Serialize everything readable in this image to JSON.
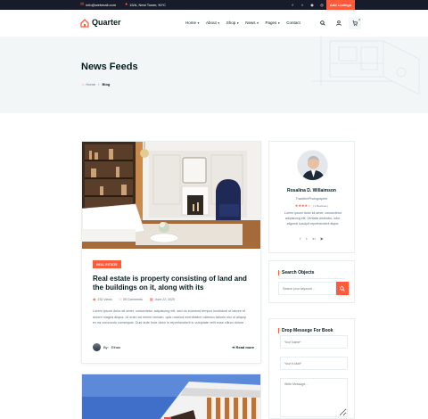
{
  "topbar": {
    "email": "info@webmail.com",
    "address": "15/A, Nest Tower, NYC",
    "social_icons": [
      "facebook-icon",
      "twitter-icon",
      "instagram-icon",
      "dribbble-icon"
    ],
    "add_listing_label": "Add Listings"
  },
  "header": {
    "logo_text": "Quarter",
    "nav": [
      {
        "label": "Home"
      },
      {
        "label": "About"
      },
      {
        "label": "Shop"
      },
      {
        "label": "News"
      },
      {
        "label": "Pages"
      },
      {
        "label": "Contact"
      }
    ],
    "cart_count": "0"
  },
  "banner": {
    "title": "News Feeds",
    "breadcrumb_home": "Home",
    "breadcrumb_current": "Blog"
  },
  "post": {
    "tag": "REAL ESTATE",
    "title": "Real estate is property consisting of land and the buildings on it, along with its",
    "views": "232 Views",
    "comments": "35 Comments",
    "date": "June 22, 2020",
    "excerpt": "Lorem ipsum dolor sit amet, consectetur adipisicing elit, sed do eiusmod tempor incididunt ut labore et dolore magna aliqua. Ut enim ad minim veniam, quis nostrud exercitation ullamco laboris nisi ut aliquip ex ea commodo consequat. Duis aute irure dolor in reprehenderit in voluptate velit esse cillum dolore",
    "author_prefix": "By:",
    "author": "Ethan",
    "read_more": "Read more"
  },
  "sidebar": {
    "author_name": "Rosalina D. Willaimson",
    "author_role": "Traveller/Photographer",
    "rating_text": "( 1 Reviews )",
    "author_bio": "Lorem ipsum dolor sit amet, consectetur adipisicing elit. Veritatis distinctio, odio, eligendi suscipit reprehenderit atque.",
    "search_title": "Search Objects",
    "search_placeholder": "Search your keyword...",
    "message_title": "Drop Messege For Book",
    "name_placeholder": "Your Name*",
    "email_placeholder": "Your e-Mail*",
    "message_placeholder": "Write Message..."
  },
  "colors": {
    "accent": "#ff5a3c",
    "dark": "#071c1f",
    "topbar": "#171b2a",
    "banner_bg": "#f2f6f7"
  }
}
